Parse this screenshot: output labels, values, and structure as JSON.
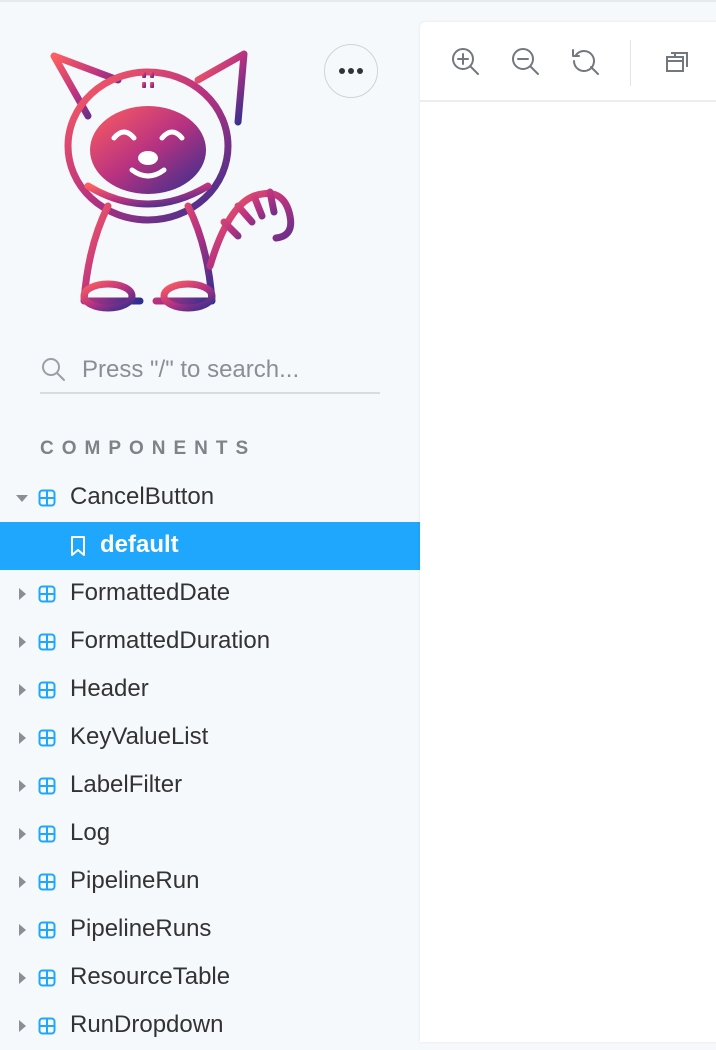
{
  "colors": {
    "selected_bg": "#1ea7fd",
    "component_icon": "#1ea7fd",
    "logo_gradient": [
      "#ff5f5f",
      "#b83280",
      "#2f2f8f"
    ]
  },
  "header": {
    "menu_icon": "ellipsis-icon"
  },
  "search": {
    "placeholder": "Press \"/\" to search...",
    "value": "",
    "icon": "search-icon"
  },
  "sidebar": {
    "section_title": "COMPONENTS",
    "items": [
      {
        "label": "CancelButton",
        "expanded": true,
        "icon": "component-icon"
      },
      {
        "label": "default",
        "story": true,
        "selected": true,
        "icon": "bookmark-icon"
      },
      {
        "label": "FormattedDate",
        "expanded": false,
        "icon": "component-icon"
      },
      {
        "label": "FormattedDuration",
        "expanded": false,
        "icon": "component-icon"
      },
      {
        "label": "Header",
        "expanded": false,
        "icon": "component-icon"
      },
      {
        "label": "KeyValueList",
        "expanded": false,
        "icon": "component-icon"
      },
      {
        "label": "LabelFilter",
        "expanded": false,
        "icon": "component-icon"
      },
      {
        "label": "Log",
        "expanded": false,
        "icon": "component-icon"
      },
      {
        "label": "PipelineRun",
        "expanded": false,
        "icon": "component-icon"
      },
      {
        "label": "PipelineRuns",
        "expanded": false,
        "icon": "component-icon"
      },
      {
        "label": "ResourceTable",
        "expanded": false,
        "icon": "component-icon"
      },
      {
        "label": "RunDropdown",
        "expanded": false,
        "icon": "component-icon"
      }
    ]
  },
  "toolbar": {
    "buttons": [
      "zoom-in-icon",
      "zoom-out-icon",
      "reset-zoom-icon",
      "background-icon"
    ]
  }
}
